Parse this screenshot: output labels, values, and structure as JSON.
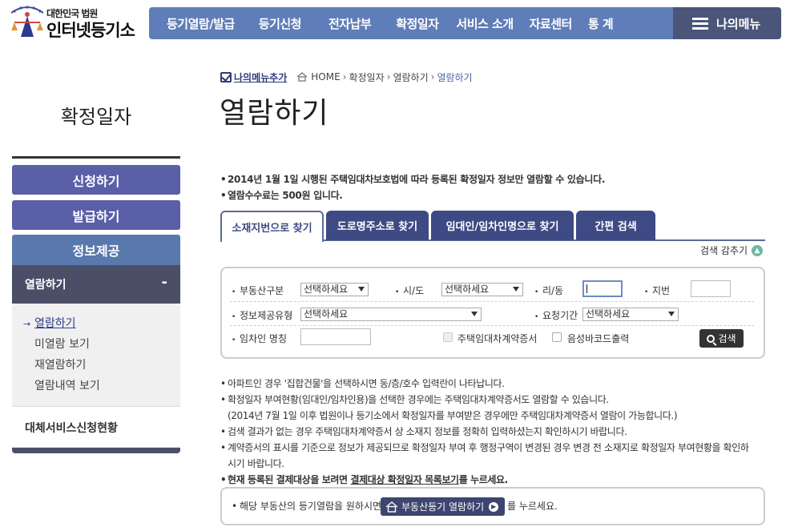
{
  "brand": {
    "small": "대한민국 법원",
    "big": "인터넷등기소"
  },
  "gnb": [
    "등기열람/발급",
    "등기신청",
    "전자납부",
    "확정일자",
    "서비스 소개",
    "자료센터",
    "통 계"
  ],
  "mymenu": "나의메뉴",
  "lnb": {
    "title": "확정일자",
    "buttons": [
      "신청하기",
      "발급하기",
      "정보제공"
    ],
    "open": "열람하기",
    "open_toggle": "-",
    "sub": [
      "열람하기",
      "미열람 보기",
      "재열람하기",
      "열람내역 보기"
    ],
    "etc": "대체서비스신청현황"
  },
  "breadcrumb": {
    "add": "나의메뉴추가",
    "home": "HOME",
    "items": [
      "확정일자",
      "열람하기"
    ],
    "current": "열람하기"
  },
  "page_title": "열람하기",
  "notices": [
    "2014년 1월 1일 시행된 주택임대차보호법에 따라 등록된 확정일자 정보만 열람할 수 있습니다.",
    "열람수수료는 500원 입니다."
  ],
  "tabs": [
    "소재지번으로 찾기",
    "도로명주소로 찾기",
    "임대인/임차인명으로 찾기",
    "간편 검색"
  ],
  "hide_search": "검색 감추기",
  "search": {
    "property_type": {
      "label": "부동산구분",
      "value": "선택하세요"
    },
    "sido": {
      "label": "시/도",
      "value": "선택하세요"
    },
    "ri_dong": {
      "label": "리/동"
    },
    "jibun": {
      "label": "지번"
    },
    "info_type": {
      "label": "정보제공유형",
      "value": "선택하세요"
    },
    "request_period": {
      "label": "요청기간",
      "value": "선택하세요"
    },
    "tenant_name": {
      "label": "임차인 명칭"
    },
    "lease_contract": "주택임대차계약증서",
    "voice_barcode": "음성바코드출력",
    "button": "검색"
  },
  "notes": {
    "n1": "아파트인 경우 '집합건물'을 선택하시면 동/층/호수 입력란이 나타납니다.",
    "n2": "확정일자 부여현황(임대인/임차인용)을 선택한 경우에는 주택임대차계약증서도 열람할 수 있습니다.",
    "n2b": "(2014년 7월 1일 이후 법원이나 등기소에서 확정일자를 부여받은 경우에만 주택임대차계약증서 열람이 가능합니다.)",
    "n3": "검색 결과가 없는 경우 주택임대차계약증서 상 소재지 정보를 정확히 입력하셨는지 확인하시기 바랍니다.",
    "n4": "계약증서의 표시를 기준으로 정보가 제공되므로 확정일자 부여 후 행정구역이 변경된 경우 변경 전 소재지로 확정일자 부여현황을 확인하",
    "n4b": "시기 바랍니다.",
    "n5_pre": "현재 등록된 결제대상을 보려면",
    "n5_link": "결제대상 확정일자 목록보기",
    "n5_post": "를 누르세요."
  },
  "register_box": {
    "pre": "해당 부동산의 등기열람을 원하시면",
    "button": "부동산등기 열람하기",
    "post": "를 누르세요."
  },
  "colors": {
    "gnb": "#5f7db8",
    "mymenu": "#4a5578",
    "lnb_button": "#5a5fa8",
    "tab": "#3d4a83"
  }
}
